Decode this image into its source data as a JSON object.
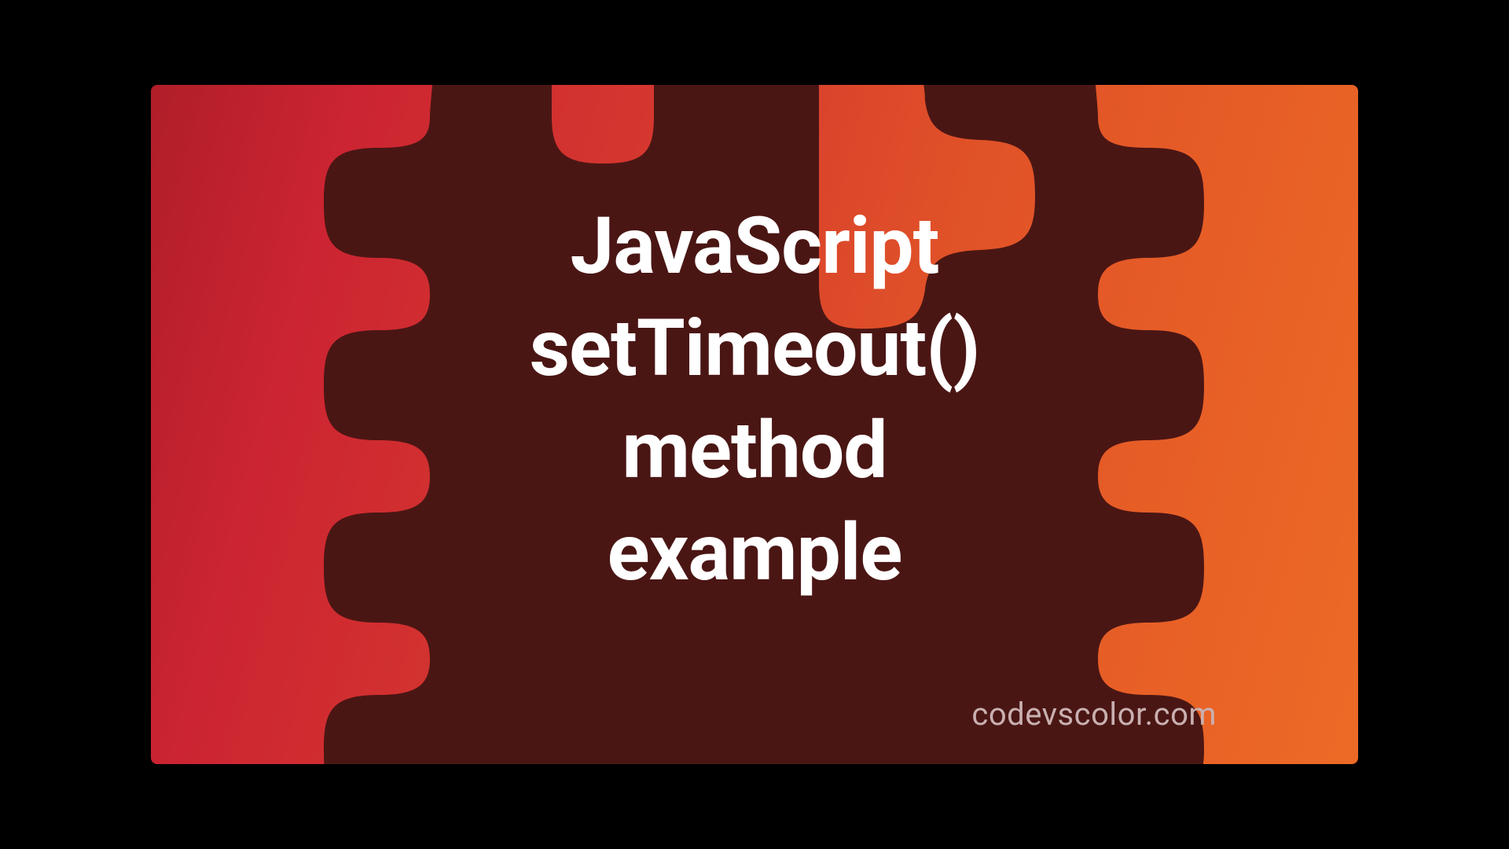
{
  "title": "JavaScript\nsetTimeout()\nmethod\nexample",
  "watermark": "codevscolor.com",
  "colors": {
    "blob_fill": "#4a1614",
    "gradient_start": "#b01e28",
    "gradient_end": "#ec6a26",
    "title_text": "#ffffff",
    "watermark_text": "#c9b0b0"
  }
}
